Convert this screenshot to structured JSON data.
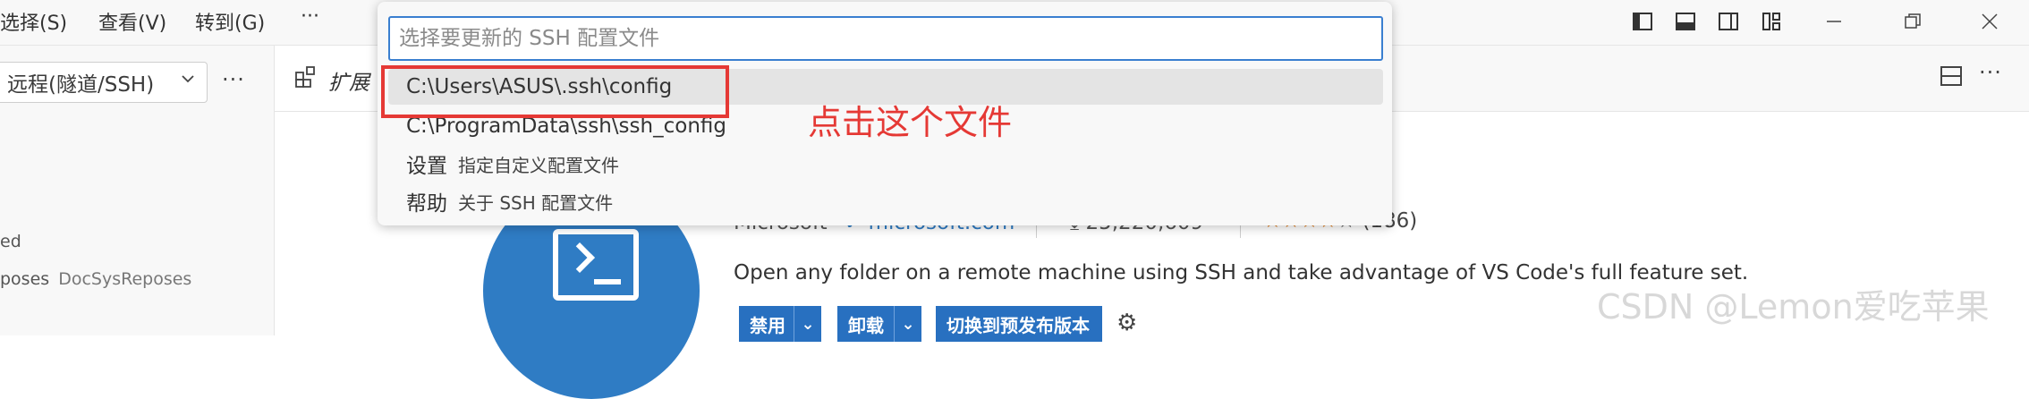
{
  "titlebar": {
    "menus": [
      "选择(S)",
      "查看(V)",
      "转到(G)",
      "···"
    ]
  },
  "sidebar": {
    "remote_select": "远程(隧道/SSH)",
    "more": "···",
    "partial_line1": "ed",
    "partial_line2_name": "poses",
    "partial_line2_detail": "DocSysReposes"
  },
  "editor": {
    "tab_label": "扩展",
    "more": "···"
  },
  "extension": {
    "publisher": "Microsoft",
    "publisher_link": "microsoft.com",
    "installs": "25,220,609",
    "rating_count": "(186)",
    "description": "Open any folder on a remote machine using SSH and take advantage of VS Code's full feature set.",
    "buttons": {
      "disable": "禁用",
      "uninstall": "卸载",
      "prerelease": "切换到预发布版本"
    }
  },
  "quickpick": {
    "placeholder": "选择要更新的 SSH 配置文件",
    "items": [
      {
        "label": "C:\\Users\\ASUS\\.ssh\\config",
        "sub": ""
      },
      {
        "label": "C:\\ProgramData\\ssh\\ssh_config",
        "sub": ""
      },
      {
        "label": "设置",
        "sub": "指定自定义配置文件"
      },
      {
        "label": "帮助",
        "sub": "关于 SSH 配置文件"
      }
    ]
  },
  "annotation": "点击这个文件",
  "watermark": "CSDN @Lemon爱吃苹果",
  "colors": {
    "accent": "#2f7cc4",
    "annotation_red": "#e53935",
    "star": "#e07b1a"
  }
}
